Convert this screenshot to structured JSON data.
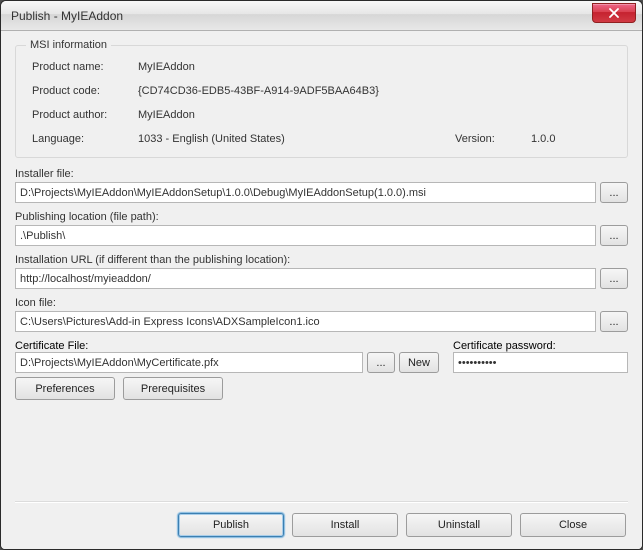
{
  "window": {
    "title": "Publish - MyIEAddon"
  },
  "msi": {
    "legend": "MSI information",
    "product_name_label": "Product name:",
    "product_name": "MyIEAddon",
    "product_code_label": "Product code:",
    "product_code": "{CD74CD36-EDB5-43BF-A914-9ADF5BAA64B3}",
    "product_author_label": "Product author:",
    "product_author": "MyIEAddon",
    "language_label": "Language:",
    "language": "1033 - English (United States)",
    "version_label": "Version:",
    "version": "1.0.0"
  },
  "installer": {
    "label": "Installer file:",
    "value": "D:\\Projects\\MyIEAddon\\MyIEAddonSetup\\1.0.0\\Debug\\MyIEAddonSetup(1.0.0).msi",
    "browse": "..."
  },
  "publishing": {
    "label": "Publishing location (file path):",
    "value": ".\\Publish\\",
    "browse": "..."
  },
  "install_url": {
    "label": "Installation URL (if different than the publishing location):",
    "value": "http://localhost/myieaddon/",
    "browse": "..."
  },
  "icon_file": {
    "label": "Icon file:",
    "value": "C:\\Users\\Pictures\\Add-in Express Icons\\ADXSampleIcon1.ico",
    "browse": "..."
  },
  "certificate": {
    "file_label": "Certificate File:",
    "file_value": "D:\\Projects\\MyIEAddon\\MyCertificate.pfx",
    "browse": "...",
    "new_btn": "New",
    "password_label": "Certificate password:",
    "password_value": "••••••••••"
  },
  "buttons": {
    "preferences": "Preferences",
    "prerequisites": "Prerequisites",
    "publish": "Publish",
    "install": "Install",
    "uninstall": "Uninstall",
    "close": "Close"
  }
}
